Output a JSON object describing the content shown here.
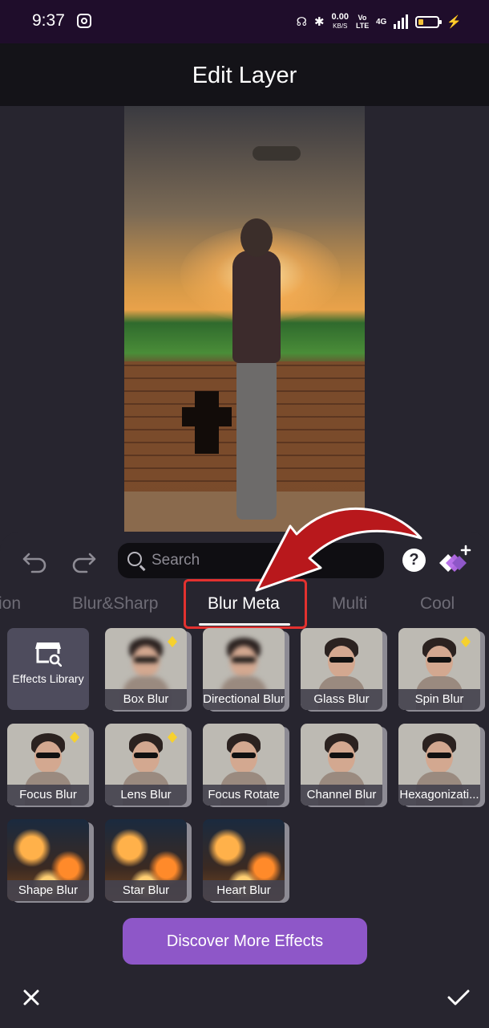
{
  "status_bar": {
    "time": "9:37",
    "network_speed_value": "0.00",
    "network_speed_unit": "KB/S",
    "volte_label": "Vo LTE",
    "network_type": "4G"
  },
  "header": {
    "title": "Edit Layer"
  },
  "toolbar": {
    "undo_icon": "undo-icon",
    "redo_icon": "redo-icon",
    "search_placeholder": "Search",
    "help_label": "?",
    "premium_icon": "premium-diamond-icon"
  },
  "tabs": [
    {
      "label": "ion",
      "active": false
    },
    {
      "label": "Blur&Sharp",
      "active": false
    },
    {
      "label": "Blur Meta",
      "active": true
    },
    {
      "label": "Multi",
      "active": false
    },
    {
      "label": "Cool",
      "active": false
    }
  ],
  "effects": {
    "library": {
      "label": "Effects Library",
      "icon": "store-search-icon"
    },
    "items": [
      {
        "label": "Box Blur",
        "premium": true
      },
      {
        "label": "Directional Blur",
        "premium": false
      },
      {
        "label": "Glass Blur",
        "premium": false
      },
      {
        "label": "Spin Blur",
        "premium": true
      },
      {
        "label": "Focus Blur",
        "premium": true
      },
      {
        "label": "Lens Blur",
        "premium": true
      },
      {
        "label": "Focus Rotate",
        "premium": false
      },
      {
        "label": "Channel Blur",
        "premium": false
      },
      {
        "label": "Hexagonizati...",
        "premium": false
      },
      {
        "label": "Shape Blur",
        "premium": false
      },
      {
        "label": "Star Blur",
        "premium": false
      },
      {
        "label": "Heart Blur",
        "premium": false
      }
    ]
  },
  "discover_button": {
    "label": "Discover More Effects"
  },
  "footer": {
    "close_icon": "close-icon",
    "confirm_icon": "check-icon"
  },
  "colors": {
    "accent": "#8e57c8",
    "highlight_red": "#e3312f",
    "premium_badge": "#f6d12e"
  }
}
